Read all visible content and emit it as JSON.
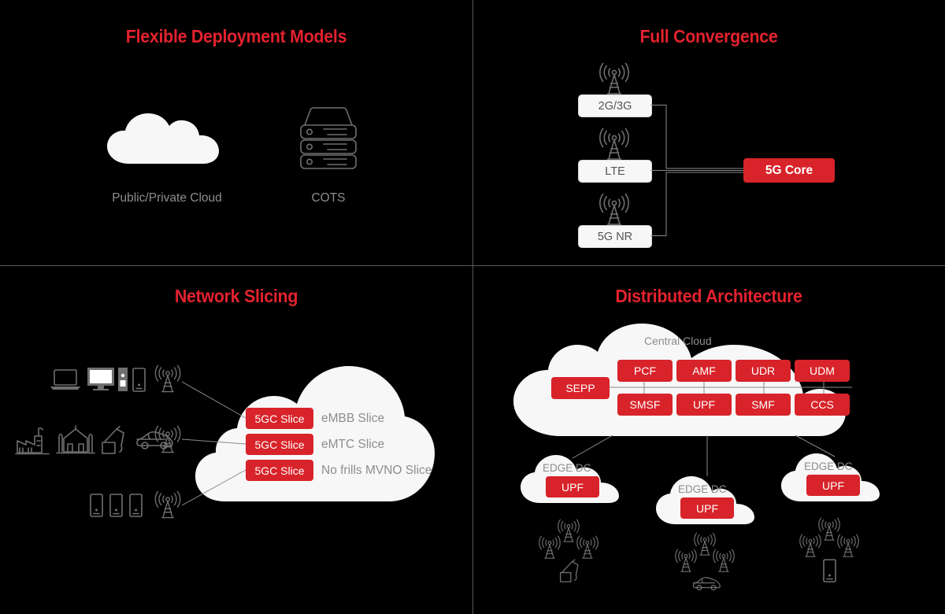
{
  "meta": {
    "background": "#000000",
    "accent_red": "#d8232a",
    "title_red": "#e4222e",
    "cloud_white": "#f7f7f7",
    "icon_gray": "#6f6f6f",
    "label_gray": "#8d8d8d",
    "divider_gray": "#5a5a5a"
  },
  "panels": {
    "flexible_deployment": {
      "title": "Flexible Deployment Models",
      "items": [
        {
          "icon": "cloud-icon",
          "label": "Public/Private Cloud"
        },
        {
          "icon": "server-stack-icon",
          "label": "COTS"
        }
      ]
    },
    "full_convergence": {
      "title": "Full Convergence",
      "radio_nodes": [
        {
          "icon": "cell-tower-icon",
          "label": "2G/3G"
        },
        {
          "icon": "cell-tower-icon",
          "label": "LTE"
        },
        {
          "icon": "cell-tower-icon",
          "label": "5G NR"
        }
      ],
      "core": {
        "label": "5G Core"
      }
    },
    "network_slicing": {
      "title": "Network Slicing",
      "device_groups": [
        {
          "icons": [
            "laptop-icon",
            "desktop-monitor-icon",
            "desktop-tower-icon",
            "tablet-icon"
          ],
          "tower": "cell-tower-icon"
        },
        {
          "icons": [
            "factory-icon",
            "city-buildings-icon",
            "excavator-icon",
            "car-icon"
          ],
          "tower": "cell-tower-icon"
        },
        {
          "icons": [
            "smartphone-icon",
            "smartphone-icon",
            "smartphone-icon"
          ],
          "tower": "cell-tower-icon"
        }
      ],
      "slices": [
        {
          "box": "5GC Slice",
          "label": "eMBB Slice"
        },
        {
          "box": "5GC Slice",
          "label": "eMTC Slice"
        },
        {
          "box": "5GC Slice",
          "label": "No frills MVNO Slice"
        }
      ]
    },
    "distributed_architecture": {
      "title": "Distributed Architecture",
      "central_cloud": {
        "label": "Central Cloud",
        "sepp": "SEPP",
        "top_row": [
          "PCF",
          "AMF",
          "UDR",
          "UDM"
        ],
        "bottom_row": [
          "SMSF",
          "UPF",
          "SMF",
          "CCS"
        ]
      },
      "edge_dcs": [
        {
          "label": "EDGE DC",
          "fn": "UPF",
          "endpoints": [
            "cell-tower-icon",
            "cell-tower-icon",
            "cell-tower-icon",
            "excavator-icon"
          ]
        },
        {
          "label": "EDGE DC",
          "fn": "UPF",
          "endpoints": [
            "cell-tower-icon",
            "cell-tower-icon",
            "cell-tower-icon",
            "car-icon"
          ]
        },
        {
          "label": "EDGE DC",
          "fn": "UPF",
          "endpoints": [
            "cell-tower-icon",
            "cell-tower-icon",
            "cell-tower-icon",
            "smartphone-icon"
          ]
        }
      ]
    }
  }
}
